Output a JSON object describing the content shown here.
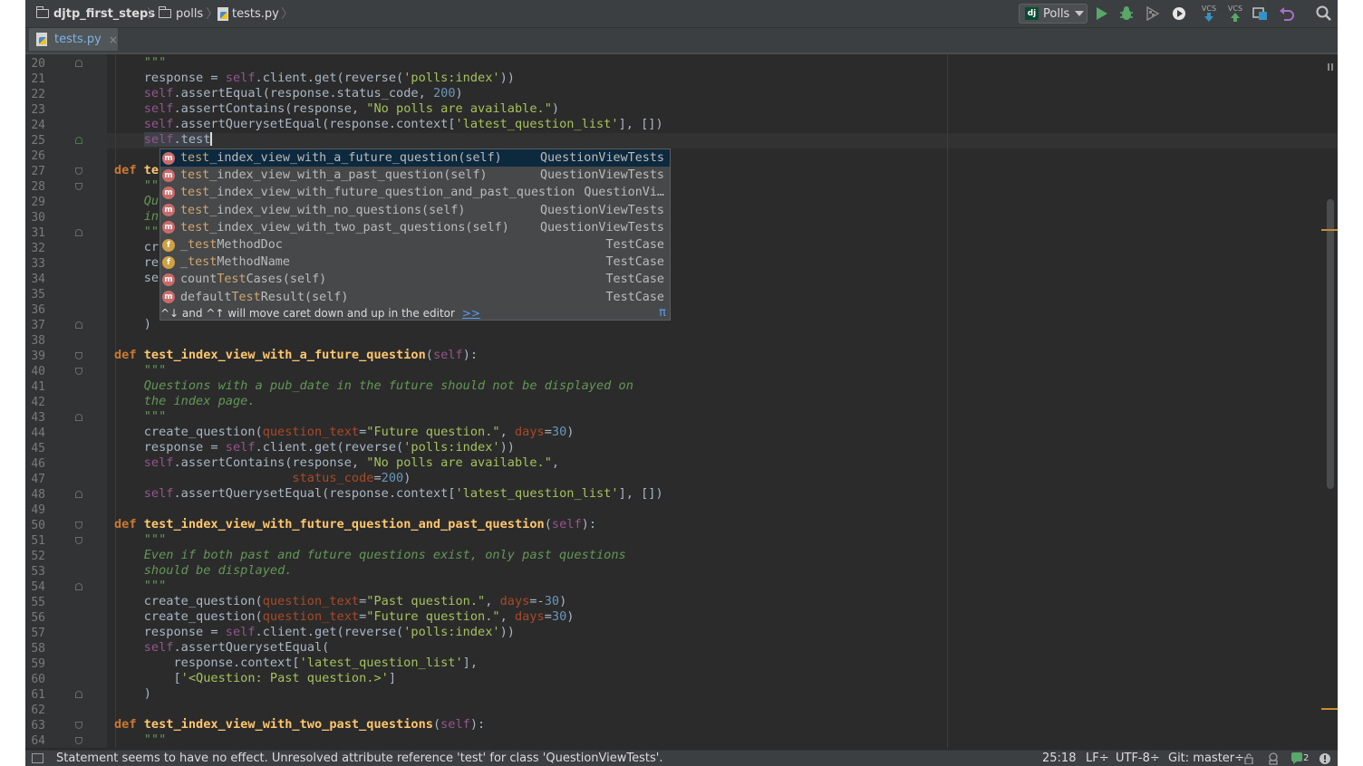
{
  "breadcrumb": {
    "project": "djtp_first_steps",
    "folder": "polls",
    "file": "tests.py"
  },
  "toolbar": {
    "run_config_badge": "dj",
    "run_config": "Polls",
    "vcs_update_label": "VCS",
    "vcs_commit_label": "VCS",
    "icons": [
      "run-icon",
      "debug-icon",
      "coverage-icon",
      "profile-icon",
      "vcs-update-icon",
      "vcs-commit-icon",
      "compare-icon",
      "revert-icon",
      "search-icon"
    ]
  },
  "tab": {
    "name": "tests.py",
    "close": "×"
  },
  "editor": {
    "line_numbers": [
      "20",
      "21",
      "22",
      "23",
      "24",
      "25",
      "26",
      "27",
      "28",
      "29",
      "30",
      "31",
      "32",
      "33",
      "34",
      "35",
      "36",
      "37",
      "38",
      "39",
      "40",
      "41",
      "42",
      "43",
      "44",
      "45",
      "46",
      "47",
      "48",
      "49",
      "50",
      "51",
      "52",
      "53",
      "54",
      "55",
      "56",
      "57",
      "58",
      "59",
      "60",
      "61",
      "62",
      "63",
      "64"
    ],
    "current_line": "25"
  },
  "completion": {
    "items": [
      {
        "prefix": "",
        "match": "test",
        "rest": "_index_view_with_a_future_question(self)",
        "type": "QuestionViewTests",
        "kind": "m"
      },
      {
        "prefix": "",
        "match": "test",
        "rest": "_index_view_with_a_past_question(self)",
        "type": "QuestionViewTests",
        "kind": "m"
      },
      {
        "prefix": "",
        "match": "test",
        "rest": "_index_view_with_future_question_and_past_question",
        "type": "QuestionVi…",
        "kind": "m"
      },
      {
        "prefix": "",
        "match": "test",
        "rest": "_index_view_with_no_questions(self)",
        "type": "QuestionViewTests",
        "kind": "m"
      },
      {
        "prefix": "",
        "match": "test",
        "rest": "_index_view_with_two_past_questions(self)",
        "type": "QuestionViewTests",
        "kind": "m"
      },
      {
        "prefix": "_",
        "match": "test",
        "rest": "MethodDoc",
        "type": "TestCase",
        "kind": "f"
      },
      {
        "prefix": "_",
        "match": "test",
        "rest": "MethodName",
        "type": "TestCase",
        "kind": "f"
      },
      {
        "prefix": "count",
        "match": "Test",
        "rest": "Cases(self)",
        "type": "TestCase",
        "kind": "m"
      },
      {
        "prefix": "default",
        "match": "Test",
        "rest": "Result(self)",
        "type": "TestCase",
        "kind": "m"
      }
    ],
    "hint": "^↓ and ^↑ will move caret down and up in the editor",
    "hint_link": ">>",
    "pi": "π"
  },
  "status": {
    "message": "Statement seems to have no effect. Unresolved attribute reference 'test' for class 'QuestionViewTests'.",
    "position": "25:18",
    "line_sep": "LF÷",
    "encoding": "UTF-8÷",
    "git": "Git: master÷",
    "event_count": "2"
  },
  "colors": {
    "background": "#2b2b2b",
    "keyword": "#cc7832",
    "string": "#a5c25c",
    "number": "#6897bb",
    "self": "#94558d",
    "function": "#ffc66d",
    "docstring": "#629755",
    "kwarg": "#aa4926"
  }
}
